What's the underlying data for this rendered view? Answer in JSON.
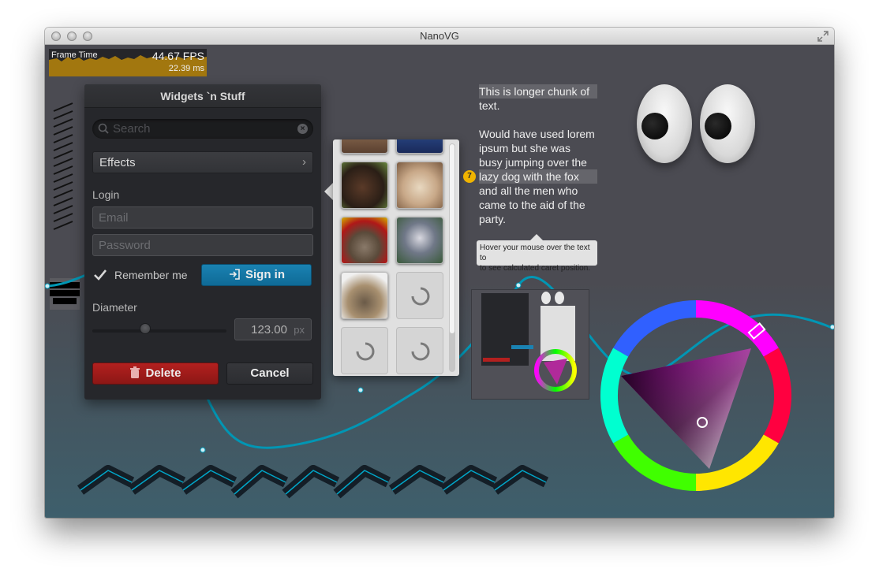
{
  "window": {
    "title": "NanoVG"
  },
  "perf": {
    "label": "Frame Time",
    "fps": "44.67 FPS",
    "ms": "22.39 ms",
    "graph_color": "#f0b400"
  },
  "panel": {
    "title": "Widgets `n Stuff",
    "search_placeholder": "Search",
    "dropdown_label": "Effects",
    "login_label": "Login",
    "email_placeholder": "Email",
    "password_placeholder": "Password",
    "remember_label": "Remember me",
    "remember_checked": true,
    "signin_label": "Sign in",
    "diameter_label": "Diameter",
    "diameter_value": "123.00",
    "diameter_unit": "px",
    "slider_value_fraction": 0.4,
    "delete_label": "Delete",
    "cancel_label": "Cancel",
    "accent_color": "#1a82b2",
    "danger_color": "#b3201f"
  },
  "thumbnails": {
    "images": [
      "shrew",
      "bunny",
      "kitten",
      "raccoon",
      "turtle"
    ],
    "loading_count": 3
  },
  "paragraph": {
    "lines": [
      "This is longer chunk of",
      "text.",
      "",
      "Would have used lorem",
      "ipsum but she    was",
      "busy jumping over the",
      "lazy dog with the fox",
      "and all the men who",
      "came to the aid of the",
      "party."
    ],
    "caret_line": "7",
    "tooltip_line1": "Hover your mouse over the text to",
    "tooltip_line2": "to see calculated caret position."
  },
  "color_wheel": {
    "selected_hue": "magenta",
    "ring_colors": [
      "#ff0000",
      "#ffff00",
      "#00ff00",
      "#00ffff",
      "#0000ff",
      "#ff00ff"
    ]
  }
}
